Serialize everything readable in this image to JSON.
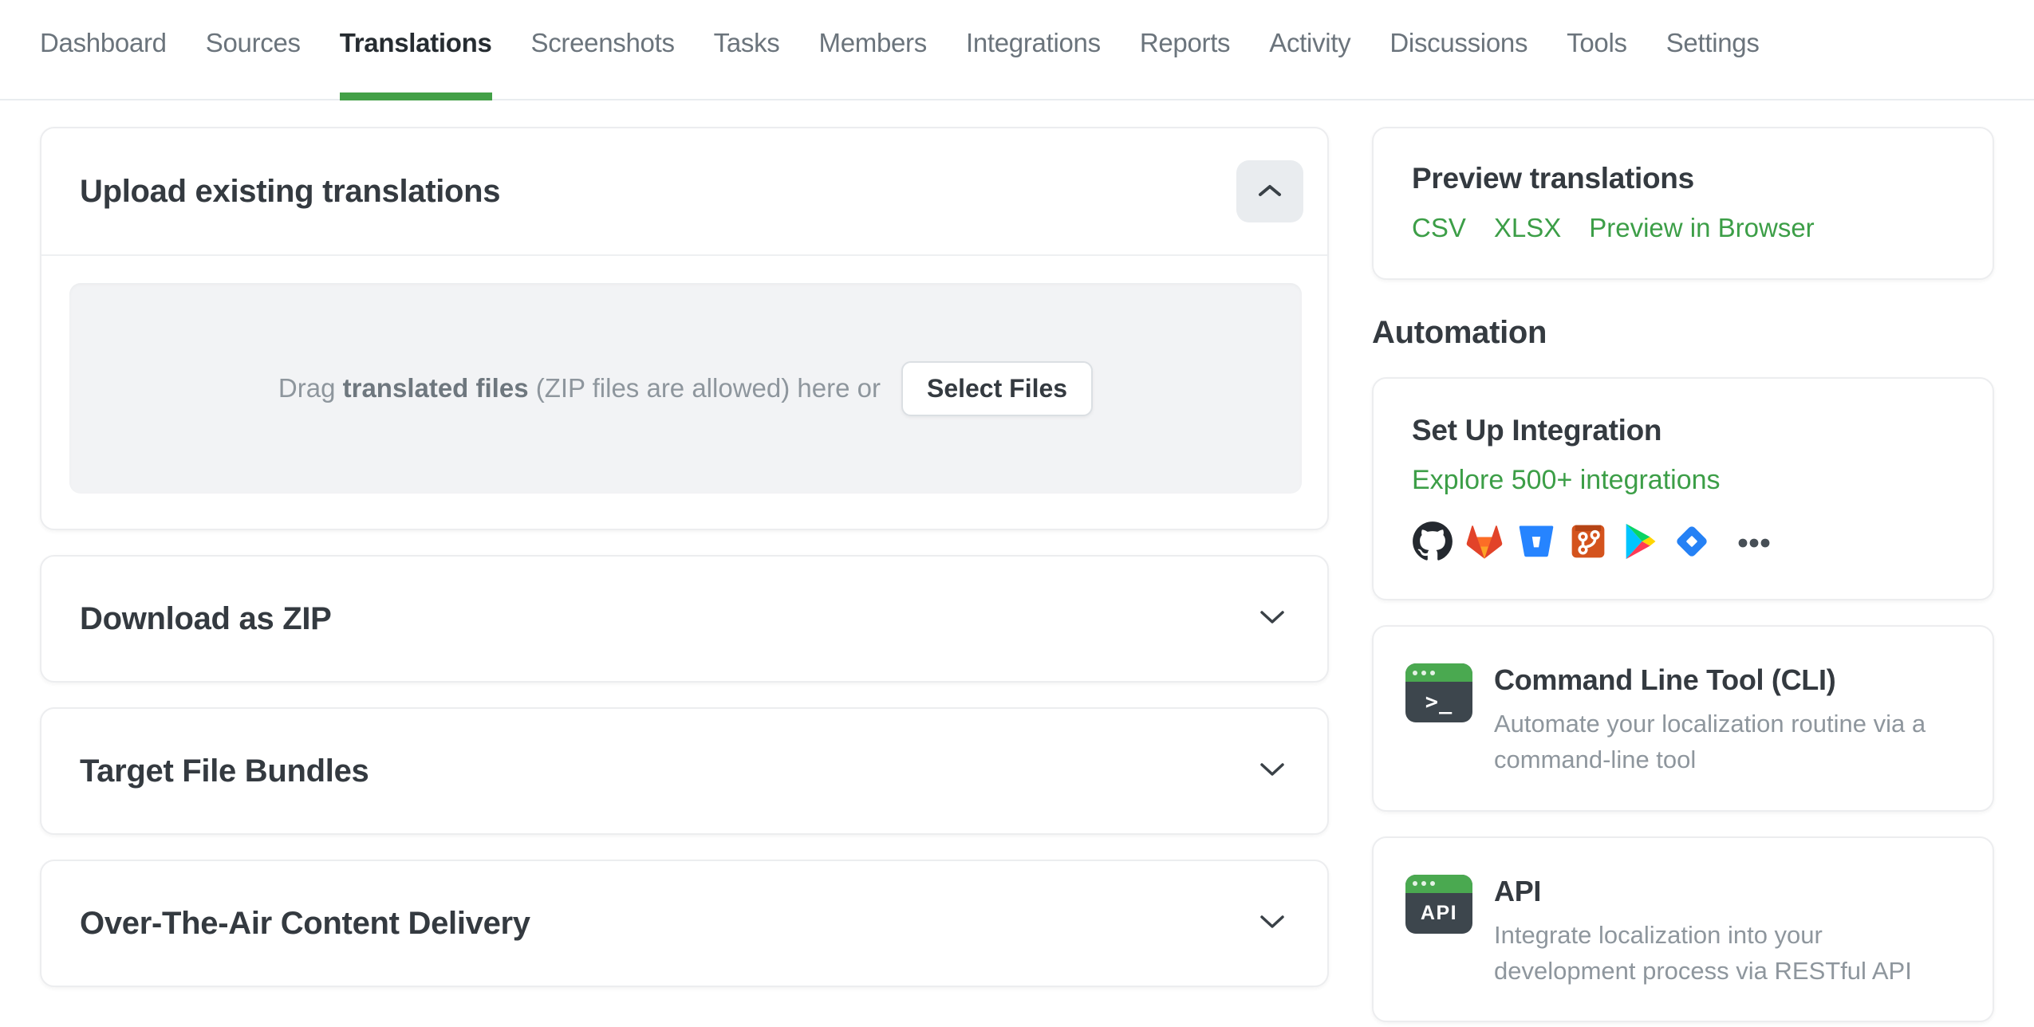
{
  "nav": {
    "items": [
      {
        "label": "Dashboard",
        "active": false
      },
      {
        "label": "Sources",
        "active": false
      },
      {
        "label": "Translations",
        "active": true
      },
      {
        "label": "Screenshots",
        "active": false
      },
      {
        "label": "Tasks",
        "active": false
      },
      {
        "label": "Members",
        "active": false
      },
      {
        "label": "Integrations",
        "active": false
      },
      {
        "label": "Reports",
        "active": false
      },
      {
        "label": "Activity",
        "active": false
      },
      {
        "label": "Discussions",
        "active": false
      },
      {
        "label": "Tools",
        "active": false
      },
      {
        "label": "Settings",
        "active": false
      }
    ]
  },
  "main": {
    "upload": {
      "title": "Upload existing translations",
      "collapse_state": "expanded",
      "dropzone": {
        "prefix": "Drag ",
        "bold": "translated files",
        "suffix": " (ZIP files are allowed) here or"
      },
      "select_files_label": "Select Files"
    },
    "sections": [
      {
        "title": "Download as ZIP",
        "collapse_state": "collapsed"
      },
      {
        "title": "Target File Bundles",
        "collapse_state": "collapsed"
      },
      {
        "title": "Over-The-Air Content Delivery",
        "collapse_state": "collapsed"
      }
    ]
  },
  "sidebar": {
    "preview": {
      "title": "Preview translations",
      "links": [
        "CSV",
        "XLSX",
        "Preview in Browser"
      ]
    },
    "automation_heading": "Automation",
    "integration": {
      "title": "Set Up Integration",
      "link": "Explore 500+ integrations",
      "icons": [
        "github",
        "gitlab",
        "bitbucket",
        "git",
        "google-play",
        "jira",
        "more-integrations"
      ]
    },
    "tools": [
      {
        "title": "Command Line Tool (CLI)",
        "description": "Automate your localization routine via a command-line tool",
        "icon_label": ">_"
      },
      {
        "title": "API",
        "description": "Integrate localization into your development process via RESTful API",
        "icon_label": "API"
      }
    ]
  },
  "colors": {
    "accent_green": "#43a047",
    "link_green": "#3c9e47",
    "title_dark": "#343a40",
    "nav_gray": "#6b747c",
    "muted_gray": "#8e969d",
    "card_border": "#ecedef",
    "dropzone_bg": "#f2f3f5",
    "collapse_btn_bg": "#e9ecef"
  }
}
